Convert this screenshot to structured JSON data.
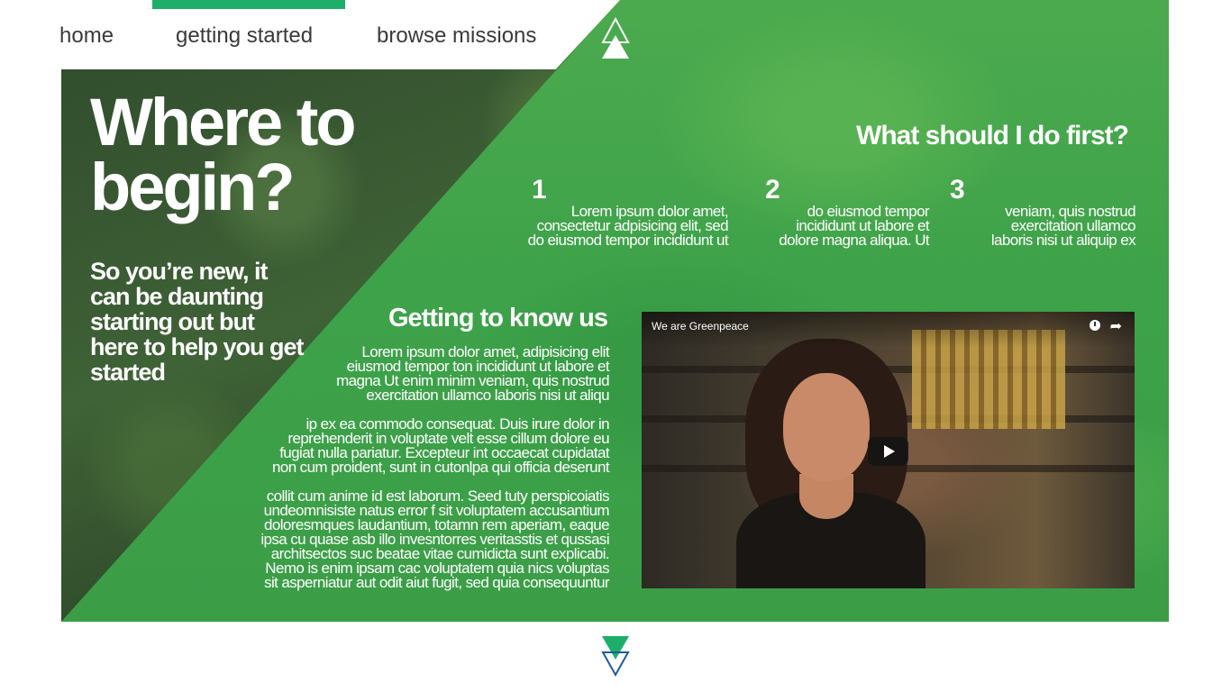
{
  "nav": {
    "items": [
      {
        "label": "home"
      },
      {
        "label": "getting started"
      },
      {
        "label": "browse missions"
      }
    ],
    "active_index": 1,
    "accent_color": "#1dae6a"
  },
  "hero": {
    "headline_line1": "Where to",
    "headline_line2": "begin?",
    "subline": "So you’re new, it can be daunting starting out but here to help you get started"
  },
  "first_steps": {
    "title": "What should I do first?",
    "steps": [
      {
        "number": "1",
        "lines": [
          "Lorem ipsum dolor amet,",
          "consectetur adpisicing elit, sed",
          "do eiusmod tempor incididunt ut"
        ]
      },
      {
        "number": "2",
        "lines": [
          "do eiusmod tempor",
          "incididunt ut labore et",
          "dolore magna aliqua. Ut"
        ]
      },
      {
        "number": "3",
        "lines": [
          "veniam, quis nostrud",
          "exercitation ullamco",
          "laboris nisi ut aliquip ex"
        ]
      }
    ]
  },
  "know_us": {
    "title": "Getting to know us",
    "paragraphs": [
      [
        "Lorem ipsum dolor amet, adipisicing elit",
        "eiusmod tempor ton incididunt ut labore et",
        "magna Ut enim minim veniam, quis nostrud",
        "exercitation ullamco laboris nisi ut aliqu"
      ],
      [
        "ip ex ea commodo consequat. Duis irure dolor in",
        "reprehenderit in voluptate velt esse cillum dolore eu",
        "fugiat nulla pariatur. Excepteur int occaecat cupidatat",
        "non cum proident, sunt in cutonlpa qui officia deserunt"
      ],
      [
        "collit cum anime id est laborum. Seed tuty perspicoiatis",
        "undeomnisiste natus error f sit voluptatem accusantium",
        "doloresmques laudantium, totamn rem aperiam, eaque",
        "ipsa cu quase asb illo invesntorres veritasstis et qussasi",
        "architsectos suc beatae vitae  cumidicta sunt explicabi.",
        "Nemo is enim ipsam cac voluptatem quia nics voluptas",
        "sit asperniatur aut odit aiut fugit, sed quia consequuntur"
      ]
    ]
  },
  "video": {
    "title": "We are Greenpeace",
    "icons": [
      "clock-icon",
      "share-icon",
      "play-icon"
    ]
  },
  "colors": {
    "green": "#3ea24a",
    "dark_forest": "#2f4a2c",
    "accent": "#1dae6a",
    "arrow_blue": "#1e5aa0"
  }
}
